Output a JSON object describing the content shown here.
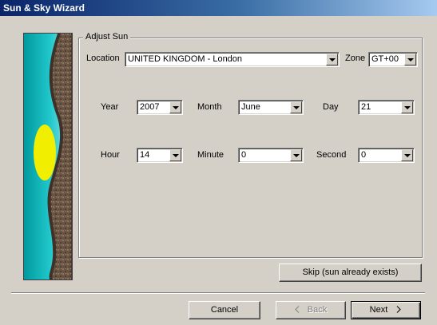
{
  "window": {
    "title": "Sun & Sky Wizard"
  },
  "group": {
    "title": "Adjust Sun"
  },
  "location": {
    "label": "Location",
    "value": "UNITED KINGDOM - London"
  },
  "zone": {
    "label": "Zone",
    "value": "GT+00"
  },
  "date": {
    "year_label": "Year",
    "year": "2007",
    "month_label": "Month",
    "month": "June",
    "day_label": "Day",
    "day": "21"
  },
  "time": {
    "hour_label": "Hour",
    "hour": "14",
    "minute_label": "Minute",
    "minute": "0",
    "second_label": "Second",
    "second": "0"
  },
  "buttons": {
    "skip": "Skip (sun already exists)",
    "cancel": "Cancel",
    "back": "Back",
    "back_icon": "chevron-left-icon",
    "next": "Next",
    "next_icon": "chevron-right-icon"
  },
  "colors": {
    "title_start": "#0a246a",
    "title_end": "#a6caf0",
    "sky": "#22c8cc",
    "sun": "#f2ee00",
    "rock": "#6b5646",
    "face": "#d4d0c8"
  }
}
